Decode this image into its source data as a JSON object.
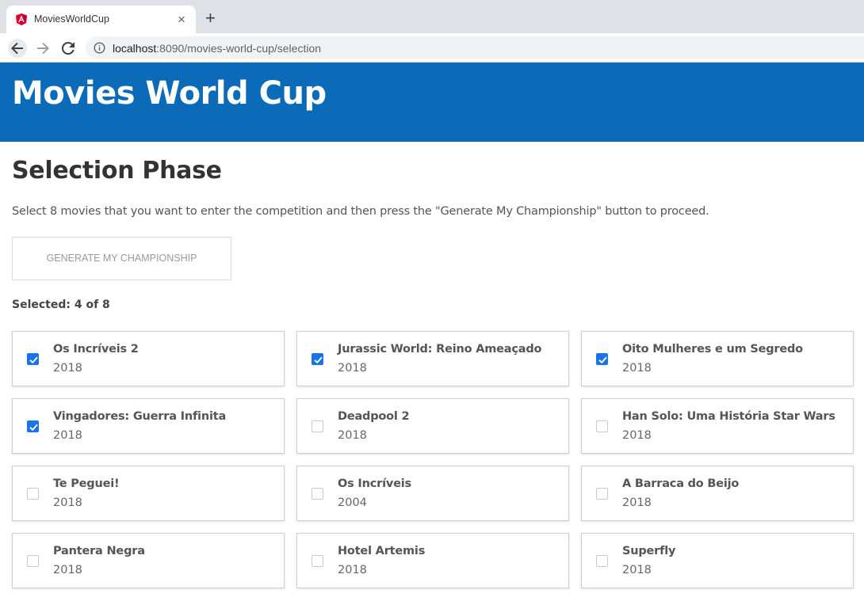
{
  "browser": {
    "tab_title": "MoviesWorldCup",
    "tab_close": "×",
    "new_tab": "+",
    "url_host": "localhost",
    "url_rest": ":8090/movies-world-cup/selection"
  },
  "app": {
    "title": "Movies World Cup",
    "header_color": "#0b6bb9"
  },
  "page": {
    "title": "Selection Phase",
    "intro": "Select 8 movies that you want to enter the competition and then press the \"Generate My Championship\" button to proceed.",
    "generate_label": "GENERATE MY CHAMPIONSHIP",
    "selected_label": "Selected: 4 of 8"
  },
  "movies": [
    {
      "title": "Os Incríveis 2",
      "year": "2018",
      "selected": true
    },
    {
      "title": "Jurassic World: Reino Ameaçado",
      "year": "2018",
      "selected": true
    },
    {
      "title": "Oito Mulheres e um Segredo",
      "year": "2018",
      "selected": true
    },
    {
      "title": "Vingadores: Guerra Infinita",
      "year": "2018",
      "selected": true
    },
    {
      "title": "Deadpool 2",
      "year": "2018",
      "selected": false
    },
    {
      "title": "Han Solo: Uma História Star Wars",
      "year": "2018",
      "selected": false
    },
    {
      "title": "Te Peguei!",
      "year": "2018",
      "selected": false
    },
    {
      "title": "Os Incríveis",
      "year": "2004",
      "selected": false
    },
    {
      "title": "A Barraca do Beijo",
      "year": "2018",
      "selected": false
    },
    {
      "title": "Pantera Negra",
      "year": "2018",
      "selected": false
    },
    {
      "title": "Hotel Artemis",
      "year": "2018",
      "selected": false
    },
    {
      "title": "Superfly",
      "year": "2018",
      "selected": false
    }
  ]
}
